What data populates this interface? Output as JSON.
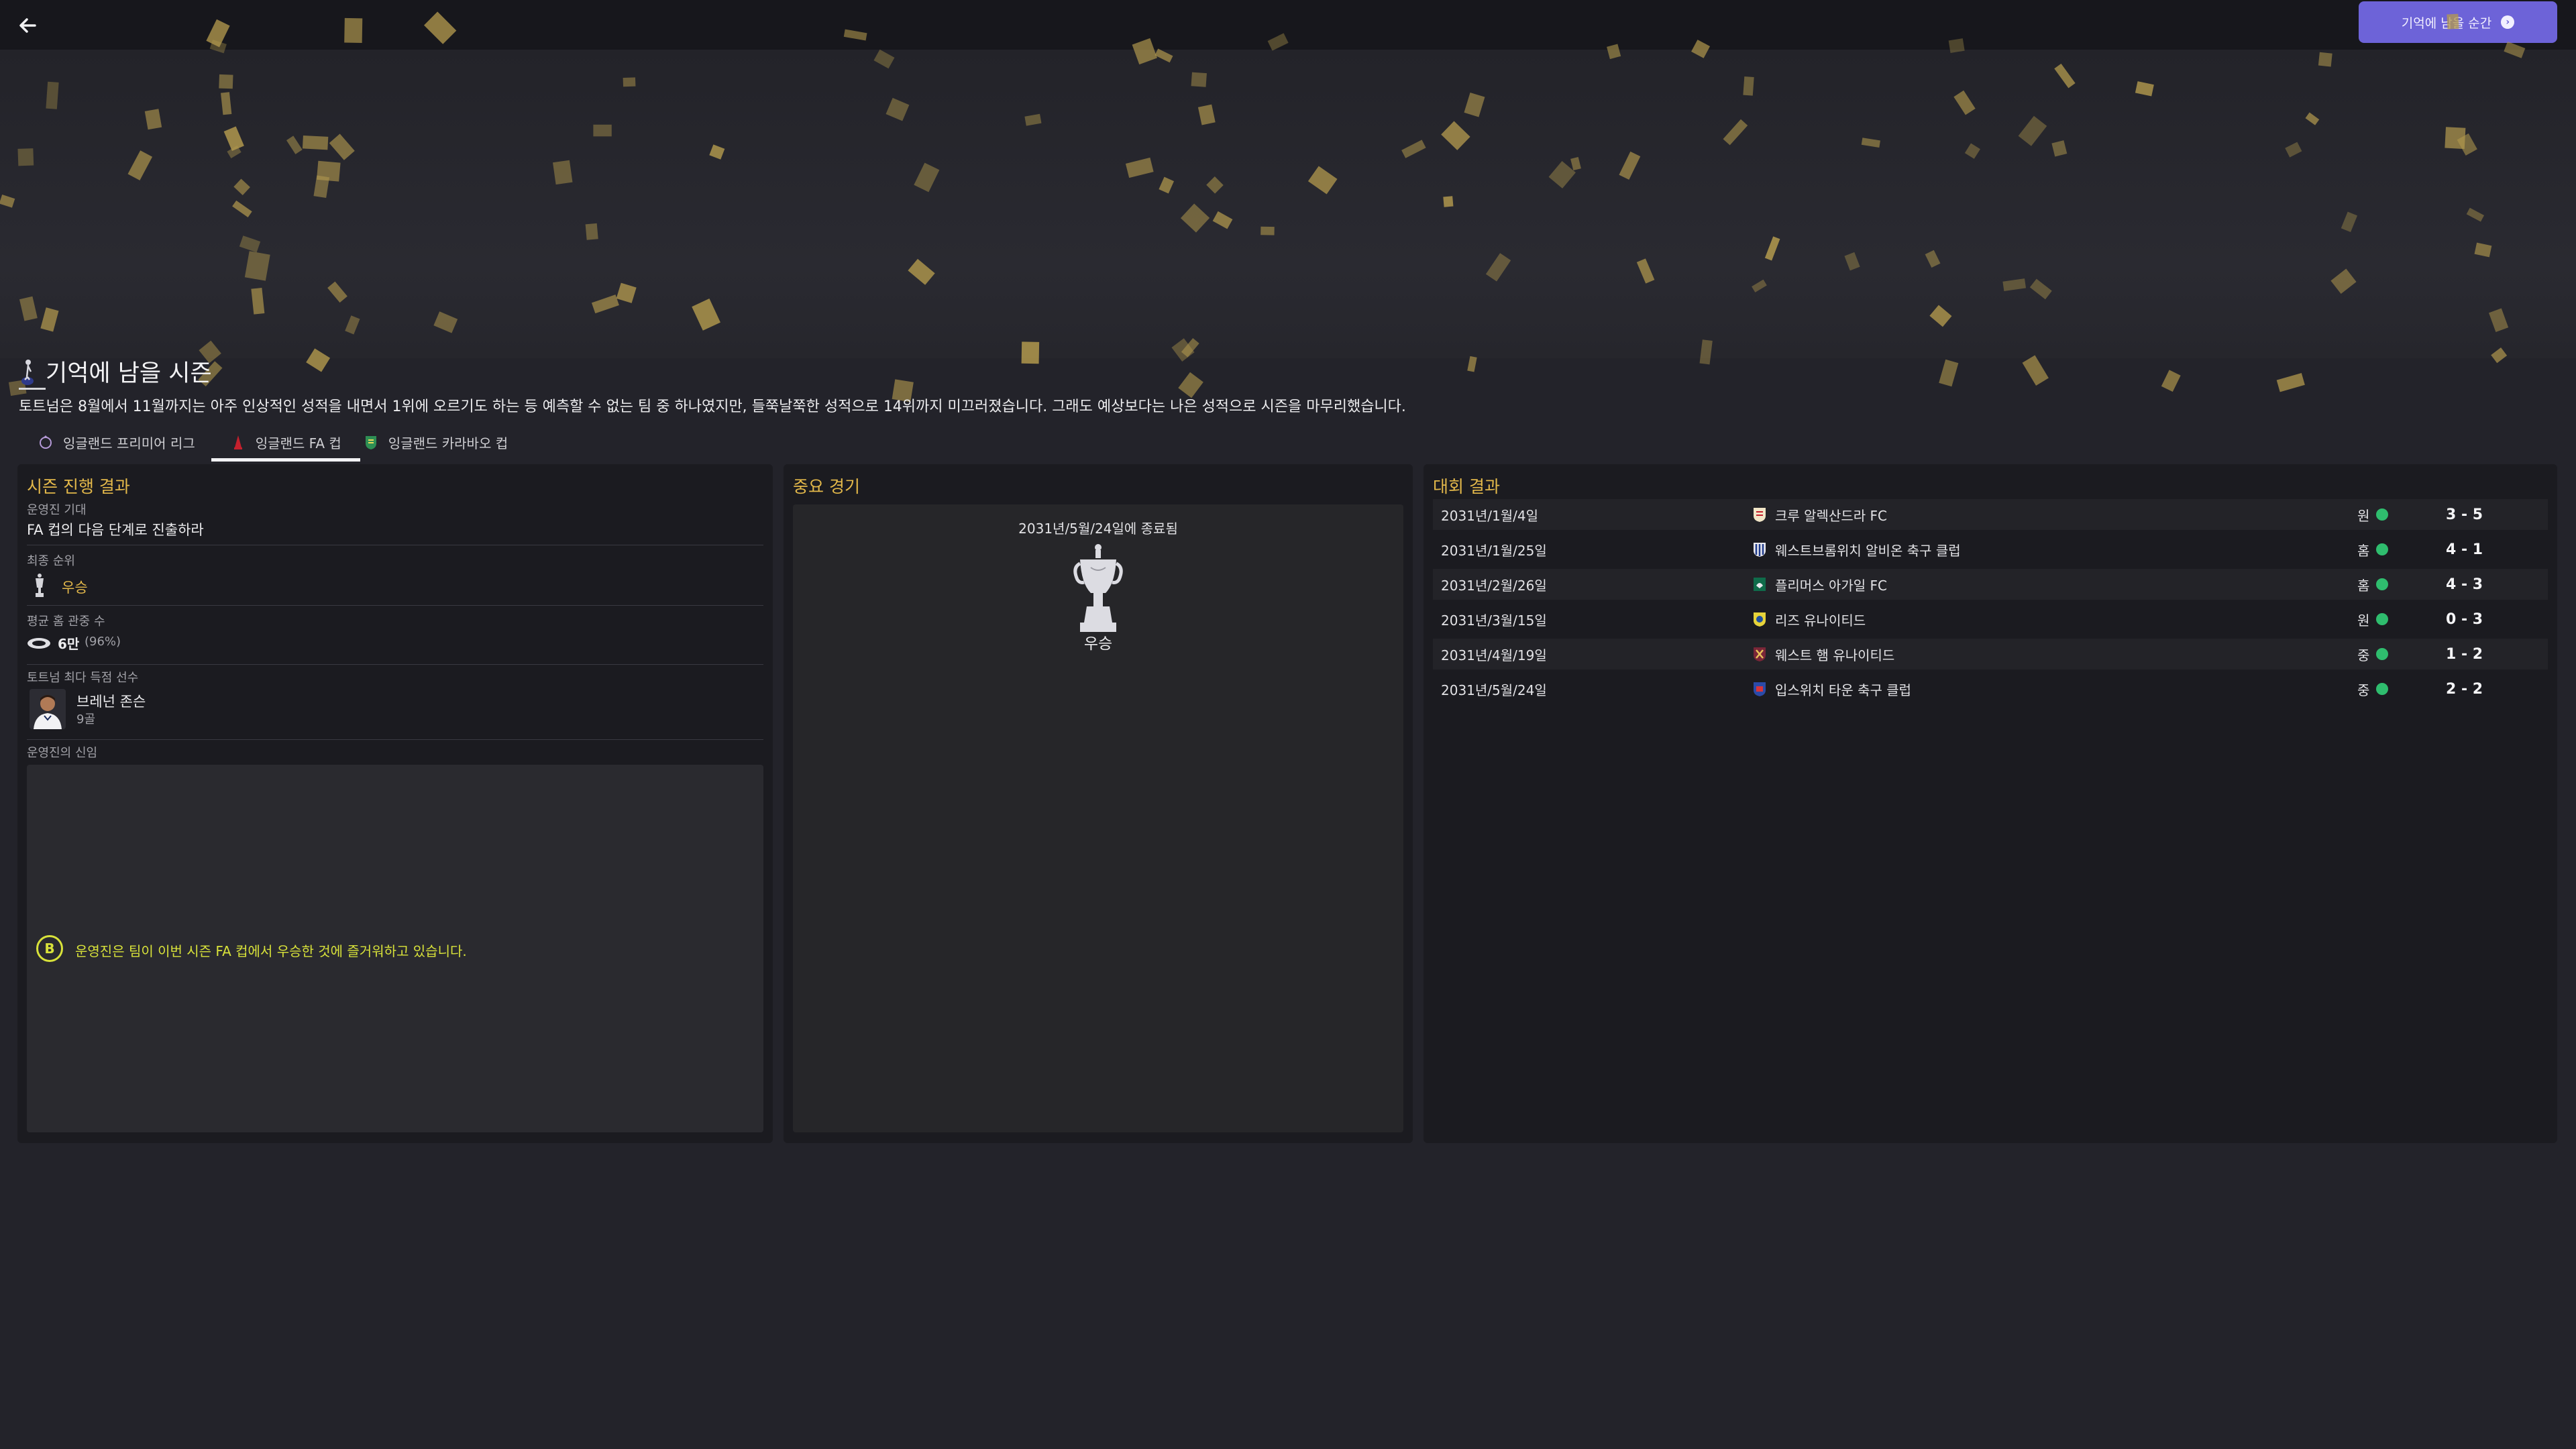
{
  "topbar": {
    "back_icon": "arrow-left-icon",
    "primary_button_label": "기억에 남을 순간",
    "primary_button_icon": "chevron-right-circle-icon",
    "accent_color": "#6d63d8"
  },
  "season": {
    "club_icon": "tottenham-crest-icon",
    "title": "기억에 남을 시즌",
    "description": "토트넘은 8월에서 11월까지는 아주 인상적인 성적을 내면서 1위에 오르기도 하는 등 예측할 수 없는 팀 중 하나였지만, 들쭉날쭉한 성적으로 14위까지 미끄러졌습니다. 그래도 예상보다는 나은 성적으로 시즌을 마무리했습니다."
  },
  "tabs": [
    {
      "label": "잉글랜드 프리미어 리그",
      "icon": "premier-league-icon",
      "active": false
    },
    {
      "label": "잉글랜드 FA 컵",
      "icon": "fa-cup-icon",
      "active": true
    },
    {
      "label": "잉글랜드 카라바오 컵",
      "icon": "carabao-cup-icon",
      "active": false
    }
  ],
  "progress": {
    "title": "시즌 진행 결과",
    "expectation_label": "운영진 기대",
    "expectation_value": "FA 컵의 다음 단계로 진출하라",
    "final_position_label": "최종 순위",
    "final_position_value": "우승",
    "attendance_label": "평균 홈 관중 수",
    "attendance_value": "6만",
    "attendance_pct": "(96%)",
    "top_scorer_label": "토트넘 최다 득점 선수",
    "top_scorer_name": "브레넌 존슨",
    "top_scorer_goals": "9골",
    "confidence_label": "운영진의 신임",
    "confidence_grade": "B",
    "confidence_text": "운영진은 팀이 이번 시즌 FA 컵에서 우승한 것에 즐거워하고 있습니다.",
    "gold_color": "#e3b84a",
    "confidence_color": "#d8e23a"
  },
  "key_match": {
    "title": "중요 경기",
    "date_text": "2031년/5월/24일에 종료됨",
    "trophy_icon": "fa-cup-trophy-icon",
    "result": "우승"
  },
  "results": {
    "title": "대회 결과",
    "rows": [
      {
        "date": "2031년/1월/4일",
        "crest": "crewe-crest-icon",
        "team": "크루 알렉산드라 FC",
        "venue": "원",
        "score": "3 - 5"
      },
      {
        "date": "2031년/1월/25일",
        "crest": "west-brom-crest-icon",
        "team": "웨스트브롬위치 알비온 축구 클럽",
        "venue": "홈",
        "score": "4 - 1"
      },
      {
        "date": "2031년/2월/26일",
        "crest": "plymouth-crest-icon",
        "team": "플리머스 아가일 FC",
        "venue": "홈",
        "score": "4 - 3"
      },
      {
        "date": "2031년/3월/15일",
        "crest": "leeds-crest-icon",
        "team": "리즈 유나이티드",
        "venue": "원",
        "score": "0 - 3"
      },
      {
        "date": "2031년/4월/19일",
        "crest": "west-ham-crest-icon",
        "team": "웨스트 햄 유나이티드",
        "venue": "중",
        "score": "1 - 2"
      },
      {
        "date": "2031년/5월/24일",
        "crest": "ipswich-crest-icon",
        "team": "입스위치 타운 축구 클럽",
        "venue": "중",
        "score": "2 - 2"
      }
    ],
    "win_color": "#2fbd6e"
  }
}
